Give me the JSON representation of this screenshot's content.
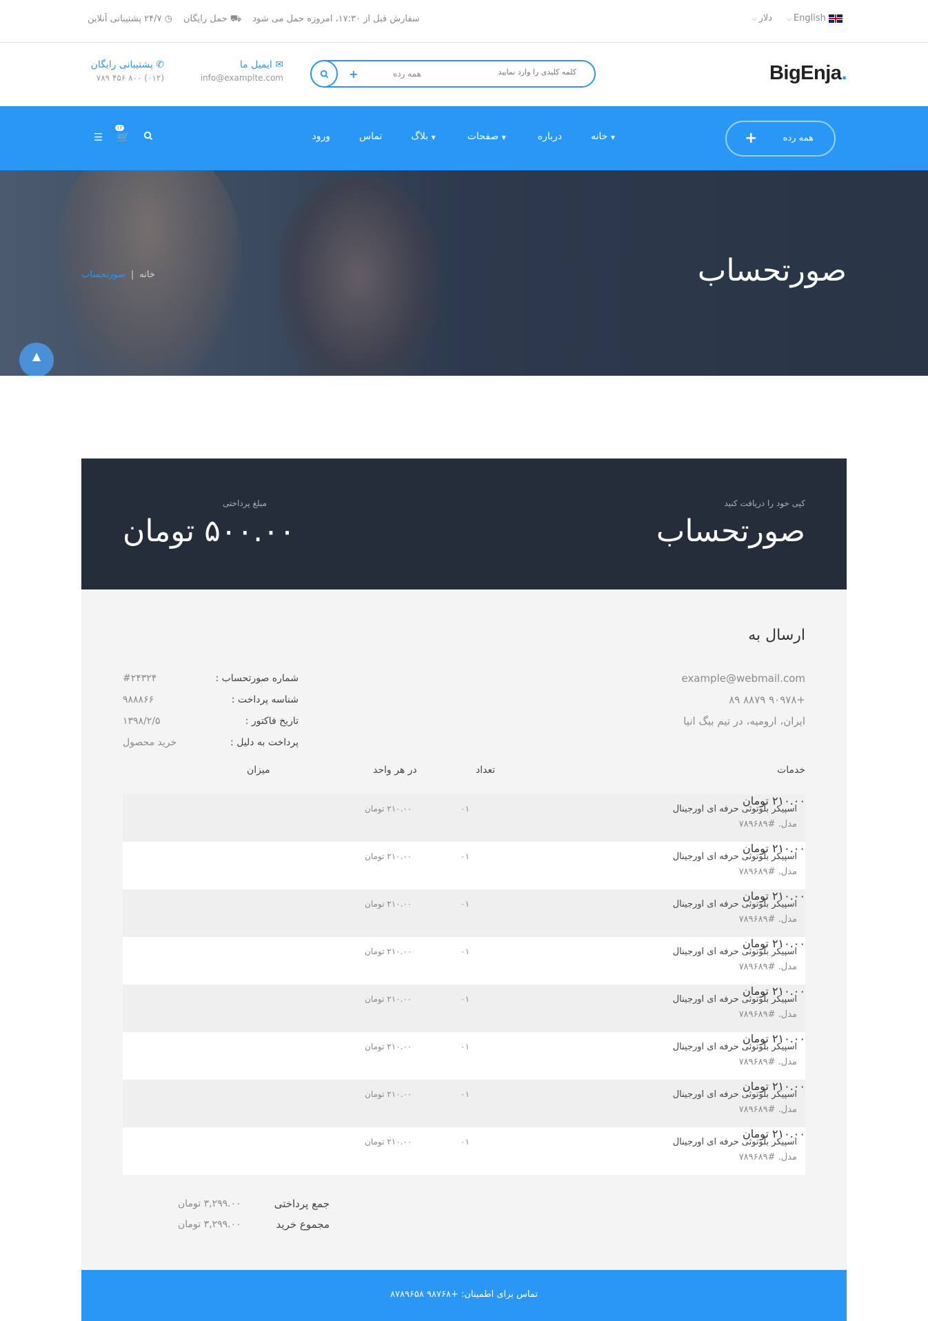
{
  "topbar": {
    "language": "English",
    "currency": "دلار",
    "order_notice": "سفارش قبل از ۱۷:۳۰، امروزه حمل می شود",
    "free_shipping": "حمل رایگان",
    "support_online": "۲۴/۷ پشتیبانی آنلاین"
  },
  "header": {
    "logo": "BigEnja",
    "logo_dot": ".",
    "search_placeholder": "کلمه کلیدی را وارد نمایید",
    "search_category": "همه رده",
    "email_title": "ایمیل ما",
    "email_value": "info@examplte.com",
    "support_title": "پشتیبانی رایگان",
    "support_value": "(۰۱۲) ۸۰۰ ۴۵۶ ۷۸۹"
  },
  "nav": {
    "all_categories": "همه رده",
    "items": [
      "خانه",
      "درباره",
      "صفحات",
      "بلاگ",
      "تماس",
      "ورود"
    ],
    "cart_count": "۱۲"
  },
  "hero": {
    "title": "صورتحساب",
    "breadcrumb_home": "خانه",
    "breadcrumb_sep": "|",
    "breadcrumb_current": "صورتحساب"
  },
  "invoice": {
    "copy_label": "کپی خود را دریافت کنید",
    "title": "صورتحساب",
    "amount_label": "مبلغ پرداختی",
    "amount": "۵۰۰.۰۰ تومان",
    "send_to": "ارسال به",
    "address": [
      "example@webmail.com",
      "+۹۰۹۷۸ ۸۸۷۹ ۸۹",
      "ایران، ارومیه، در تیم بیگ انیا"
    ],
    "meta": [
      {
        "k": "شماره صورتحساب :",
        "v": "#۲۴۳۲۴"
      },
      {
        "k": "شناسه پرداخت :",
        "v": "۹۸۸۸۶۶"
      },
      {
        "k": "تاریخ فاکتور :",
        "v": "۱۳۹۸/۲/۵"
      },
      {
        "k": "پرداخت به دلیل :",
        "v": "خرید محصول"
      }
    ],
    "headers": {
      "services": "خدمات",
      "qty": "تعداد",
      "unit": "در هر واحد",
      "amount": "میزان"
    },
    "rows": [
      {
        "name": "اسپیکر بلوتوثی حرفه ای اورجینال",
        "model": "مدل. #۷۸۹۶۸۹",
        "qty": "۰۱",
        "unit": "۲۱۰.۰۰ تومان",
        "amount": "۲۱۰.۰۰ تومان"
      },
      {
        "name": "اسپیکر بلوتوثی حرفه ای اورجینال",
        "model": "مدل. #۷۸۹۶۸۹",
        "qty": "۰۱",
        "unit": "۲۱۰.۰۰ تومان",
        "amount": "۲۱۰.۰۰ تومان"
      },
      {
        "name": "اسپیکر بلوتوثی حرفه ای اورجینال",
        "model": "مدل. #۷۸۹۶۸۹",
        "qty": "۰۱",
        "unit": "۲۱۰.۰۰ تومان",
        "amount": "۲۱۰.۰۰ تومان"
      },
      {
        "name": "اسپیکر بلوتوثی حرفه ای اورجینال",
        "model": "مدل. #۷۸۹۶۸۹",
        "qty": "۰۱",
        "unit": "۲۱۰.۰۰ تومان",
        "amount": "۲۱۰.۰۰ تومان"
      },
      {
        "name": "اسپیکر بلوتوثی حرفه ای اورجینال",
        "model": "مدل. #۷۸۹۶۸۹",
        "qty": "۰۱",
        "unit": "۲۱۰.۰۰ تومان",
        "amount": "۲۱۰.۰۰ تومان"
      },
      {
        "name": "اسپیکر بلوتوثی حرفه ای اورجینال",
        "model": "مدل. #۷۸۹۶۸۹",
        "qty": "۰۱",
        "unit": "۲۱۰.۰۰ تومان",
        "amount": "۲۱۰.۰۰ تومان"
      },
      {
        "name": "اسپیکر بلوتوثی حرفه ای اورجینال",
        "model": "مدل. #۷۸۹۶۸۹",
        "qty": "۰۱",
        "unit": "۲۱۰.۰۰ تومان",
        "amount": "۲۱۰.۰۰ تومان"
      },
      {
        "name": "اسپیکر بلوتوثی حرفه ای اورجینال",
        "model": "مدل. #۷۸۹۶۸۹",
        "qty": "۰۱",
        "unit": "۲۱۰.۰۰ تومان",
        "amount": "۲۱۰.۰۰ تومان"
      }
    ],
    "total_paid_label": "جمع پرداختی",
    "total_paid": "۳,۲۹۹.۰۰ تومان",
    "total_purchase_label": "مجموع خرید",
    "total_purchase": "۳,۲۹۹.۰۰ تومان",
    "footer": "تماس برای اطمینان: +۹۸۷۶۸ ۸۷۸۹۶۵۸"
  },
  "colors": {
    "accent": "#2997f5",
    "dark": "#252c3a",
    "panel": "#f4f4f4"
  }
}
